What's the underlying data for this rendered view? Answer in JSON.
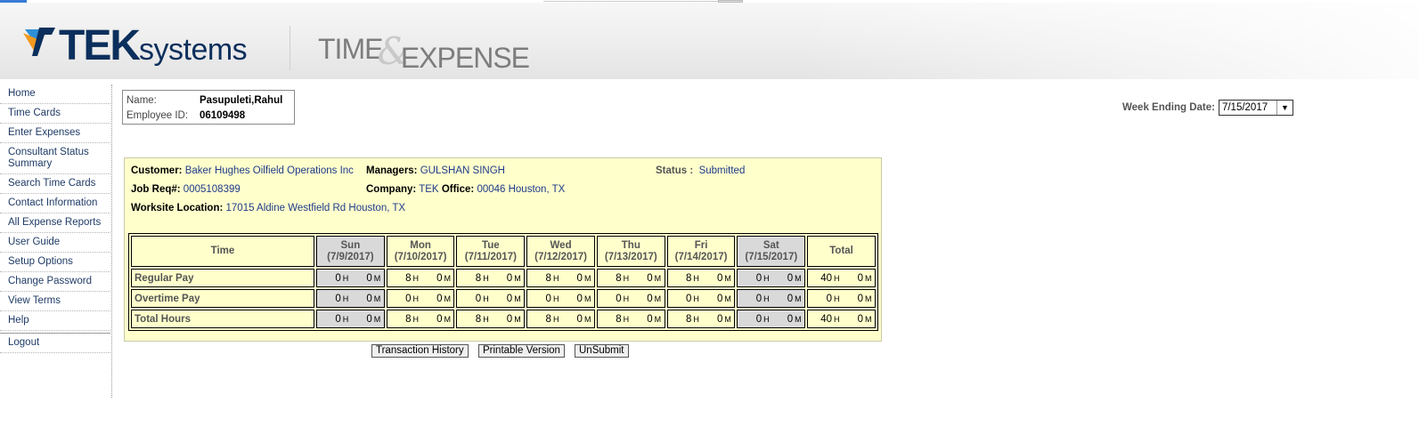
{
  "header": {
    "brand_tek": "TEK",
    "brand_systems": "systems",
    "product_time": "TIME",
    "product_amp": "&",
    "product_expense": "EXPENSE"
  },
  "sidebar": {
    "items": [
      {
        "label": "Home"
      },
      {
        "label": "Time Cards"
      },
      {
        "label": "Enter Expenses"
      },
      {
        "label": "Consultant Status Summary"
      },
      {
        "label": "Search Time Cards"
      },
      {
        "label": "Contact Information"
      },
      {
        "label": "All Expense Reports"
      },
      {
        "label": "User Guide"
      },
      {
        "label": "Setup Options"
      },
      {
        "label": "Change Password"
      },
      {
        "label": "View Terms"
      },
      {
        "label": "Help"
      },
      {
        "label": "Logout"
      }
    ]
  },
  "employee": {
    "name_label": "Name:",
    "name": "Pasupuleti,Rahul",
    "id_label": "Employee ID:",
    "id": "06109498"
  },
  "week": {
    "label": "Week Ending Date:",
    "value": "7/15/2017"
  },
  "details": {
    "customer_label": "Customer:",
    "customer": "Baker Hughes Oilfield Operations Inc",
    "managers_label": "Managers:",
    "managers": "GULSHAN SINGH",
    "status_label": "Status :",
    "status": "Submitted",
    "jobreq_label": "Job Req#:",
    "jobreq": "0005108399",
    "company_label": "Company:",
    "company": "TEK",
    "office_label": "Office:",
    "office": "00046 Houston, TX",
    "worksite_label": "Worksite Location:",
    "worksite": "17015 Aldine Westfield Rd Houston, TX"
  },
  "timesheet": {
    "time_header": "Time",
    "columns": [
      {
        "day": "Sun",
        "date": "(7/9/2017)"
      },
      {
        "day": "Mon",
        "date": "(7/10/2017)"
      },
      {
        "day": "Tue",
        "date": "(7/11/2017)"
      },
      {
        "day": "Wed",
        "date": "(7/12/2017)"
      },
      {
        "day": "Thu",
        "date": "(7/13/2017)"
      },
      {
        "day": "Fri",
        "date": "(7/14/2017)"
      },
      {
        "day": "Sat",
        "date": "(7/15/2017)"
      }
    ],
    "total_header": "Total",
    "hour_unit": "H",
    "minute_unit": "M",
    "rows": [
      {
        "label": "Regular Pay",
        "cells": [
          [
            "0",
            "0"
          ],
          [
            "8",
            "0"
          ],
          [
            "8",
            "0"
          ],
          [
            "8",
            "0"
          ],
          [
            "8",
            "0"
          ],
          [
            "8",
            "0"
          ],
          [
            "0",
            "0"
          ]
        ],
        "total": [
          "40",
          "0"
        ]
      },
      {
        "label": "Overtime Pay",
        "cells": [
          [
            "0",
            "0"
          ],
          [
            "0",
            "0"
          ],
          [
            "0",
            "0"
          ],
          [
            "0",
            "0"
          ],
          [
            "0",
            "0"
          ],
          [
            "0",
            "0"
          ],
          [
            "0",
            "0"
          ]
        ],
        "total": [
          "0",
          "0"
        ]
      },
      {
        "label": "Total Hours",
        "cells": [
          [
            "0",
            "0"
          ],
          [
            "8",
            "0"
          ],
          [
            "8",
            "0"
          ],
          [
            "8",
            "0"
          ],
          [
            "8",
            "0"
          ],
          [
            "8",
            "0"
          ],
          [
            "0",
            "0"
          ]
        ],
        "total": [
          "40",
          "0"
        ]
      }
    ]
  },
  "buttons": {
    "history": "Transaction History",
    "printable": "Printable Version",
    "unsubmit": "UnSubmit"
  },
  "colors": {
    "panel_bg": "#ffffcc",
    "weekend_bg": "#d9d9d9",
    "brand_navy": "#0b2f5c",
    "link_blue": "#1f3b8a"
  }
}
